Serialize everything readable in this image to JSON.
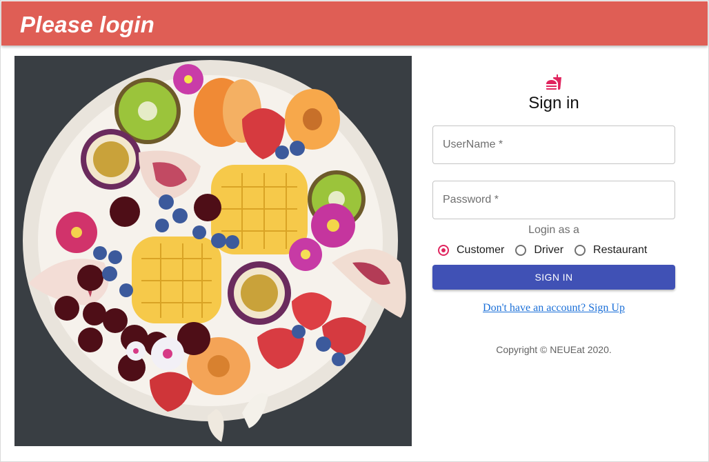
{
  "header": {
    "title": "Please login",
    "color": "#df5e55"
  },
  "hero": {
    "subject": "fruit-bowl-photo"
  },
  "form": {
    "icon": "fastfood-icon",
    "title": "Sign in",
    "username": {
      "placeholder": "UserName *",
      "value": ""
    },
    "password": {
      "placeholder": "Password *",
      "value": ""
    },
    "role_label": "Login as a",
    "roles": [
      {
        "label": "Customer",
        "selected": true
      },
      {
        "label": "Driver",
        "selected": false
      },
      {
        "label": "Restaurant",
        "selected": false
      }
    ],
    "submit_label": "SIGN IN",
    "signup_link": "Don't have an account? Sign Up",
    "accent_color": "#e0245e",
    "button_color": "#4051b5",
    "link_color": "#1a6fd8"
  },
  "footer": {
    "copyright": "Copyright © NEUEat 2020."
  }
}
